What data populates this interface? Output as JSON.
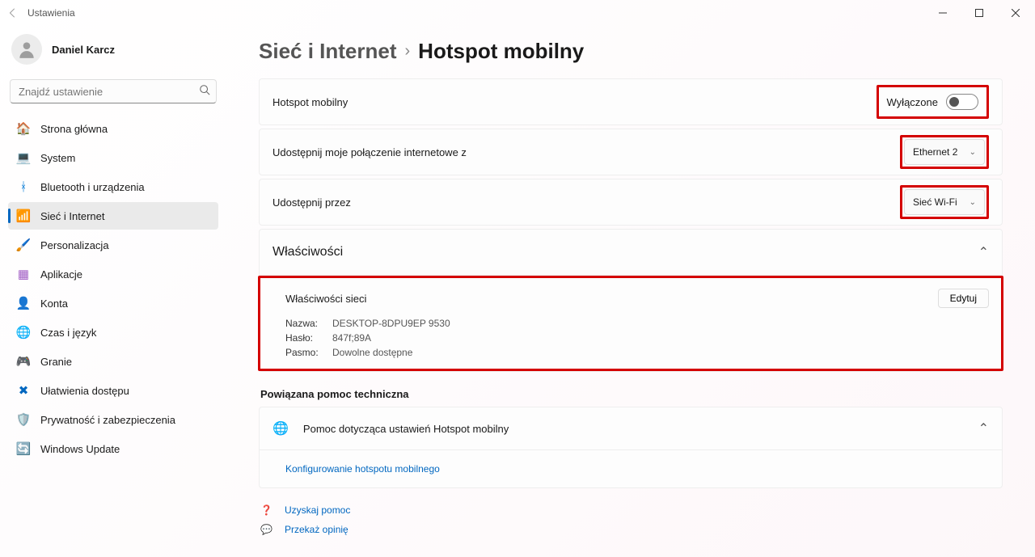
{
  "titlebar": {
    "title": "Ustawienia"
  },
  "user": {
    "name": "Daniel Karcz"
  },
  "search": {
    "placeholder": "Znajdź ustawienie"
  },
  "nav": {
    "home": "Strona główna",
    "system": "System",
    "bluetooth": "Bluetooth i urządzenia",
    "network": "Sieć i Internet",
    "personalization": "Personalizacja",
    "apps": "Aplikacje",
    "accounts": "Konta",
    "time": "Czas i język",
    "gaming": "Granie",
    "accessibility": "Ułatwienia dostępu",
    "privacy": "Prywatność i zabezpieczenia",
    "update": "Windows Update"
  },
  "breadcrumb": {
    "parent": "Sieć i Internet",
    "current": "Hotspot mobilny"
  },
  "rows": {
    "hotspot": {
      "label": "Hotspot mobilny",
      "state": "Wyłączone"
    },
    "share_from": {
      "label": "Udostępnij moje połączenie internetowe z",
      "value": "Ethernet 2"
    },
    "share_over": {
      "label": "Udostępnij przez",
      "value": "Sieć Wi-Fi"
    },
    "properties": {
      "label": "Właściwości"
    }
  },
  "props": {
    "heading": "Właściwości sieci",
    "edit": "Edytuj",
    "name_label": "Nazwa:",
    "name_value": "DESKTOP-8DPU9EP 9530",
    "password_label": "Hasło:",
    "password_value": "847f;89A",
    "band_label": "Pasmo:",
    "band_value": "Dowolne dostępne"
  },
  "related": {
    "heading": "Powiązana pomoc techniczna",
    "help_title": "Pomoc dotycząca ustawień Hotspot mobilny",
    "link": "Konfigurowanie hotspotu mobilnego"
  },
  "footer": {
    "get_help": "Uzyskaj pomoc",
    "feedback": "Przekaż opinię"
  }
}
